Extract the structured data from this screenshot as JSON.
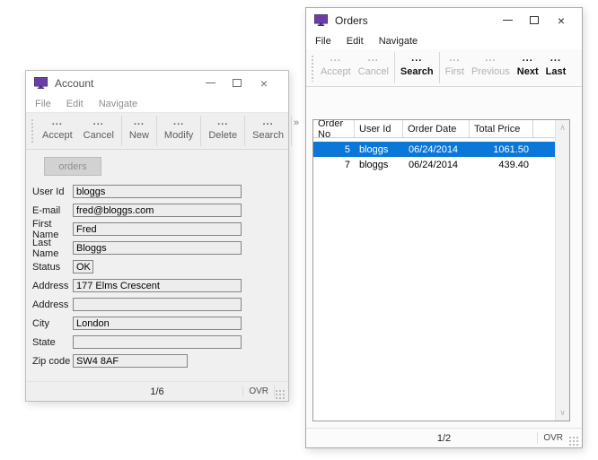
{
  "icons": {
    "ellipsis": "...",
    "close": "×",
    "overflow_chevron": "»",
    "scroll_up": "∧",
    "scroll_down": "∨"
  },
  "colors": {
    "selection_blue": "#0a77d9",
    "window_gray": "#f0f0f0",
    "titlebar_white": "#ffffff",
    "window_icon_purple": "#6a3da6"
  },
  "account": {
    "title": "Account",
    "menu": [
      {
        "label": "File"
      },
      {
        "label": "Edit"
      },
      {
        "label": "Navigate"
      }
    ],
    "toolbar": {
      "buttons": [
        {
          "label": "Accept"
        },
        {
          "label": "Cancel"
        },
        {
          "label": "New"
        },
        {
          "label": "Modify"
        },
        {
          "label": "Delete"
        },
        {
          "label": "Search"
        }
      ]
    },
    "orders_button_label": "orders",
    "fields": [
      {
        "label": "User Id",
        "value": "bloggs"
      },
      {
        "label": "E-mail",
        "value": "fred@bloggs.com"
      },
      {
        "label": "First Name",
        "value": "Fred"
      },
      {
        "label": "Last Name",
        "value": "Bloggs"
      },
      {
        "label": "Status",
        "value": "OK"
      },
      {
        "label": "Address",
        "value": "177 Elms Crescent"
      },
      {
        "label": "Address",
        "value": ""
      },
      {
        "label": "City",
        "value": "London"
      },
      {
        "label": "State",
        "value": ""
      },
      {
        "label": "Zip code",
        "value": "SW4 8AF"
      }
    ],
    "status": {
      "page": "1/6",
      "mode": "OVR"
    }
  },
  "orders": {
    "title": "Orders",
    "menu": [
      {
        "label": "File"
      },
      {
        "label": "Edit"
      },
      {
        "label": "Navigate"
      }
    ],
    "toolbar": {
      "buttons": [
        {
          "label": "Accept",
          "enabled": false
        },
        {
          "label": "Cancel",
          "enabled": false
        },
        {
          "label": "Search",
          "enabled": true
        },
        {
          "label": "First",
          "enabled": false
        },
        {
          "label": "Previous",
          "enabled": false
        },
        {
          "label": "Next",
          "enabled": true
        },
        {
          "label": "Last",
          "enabled": true
        }
      ]
    },
    "table": {
      "columns": [
        {
          "label": "Order No"
        },
        {
          "label": "User Id"
        },
        {
          "label": "Order Date"
        },
        {
          "label": "Total Price"
        },
        {
          "label": ""
        }
      ],
      "rows": [
        {
          "order_no": "5",
          "user_id": "bloggs",
          "order_date": "06/24/2014",
          "total_price": "1061.50",
          "selected": true
        },
        {
          "order_no": "7",
          "user_id": "bloggs",
          "order_date": "06/24/2014",
          "total_price": "439.40",
          "selected": false
        }
      ]
    },
    "status": {
      "page": "1/2",
      "mode": "OVR"
    }
  }
}
